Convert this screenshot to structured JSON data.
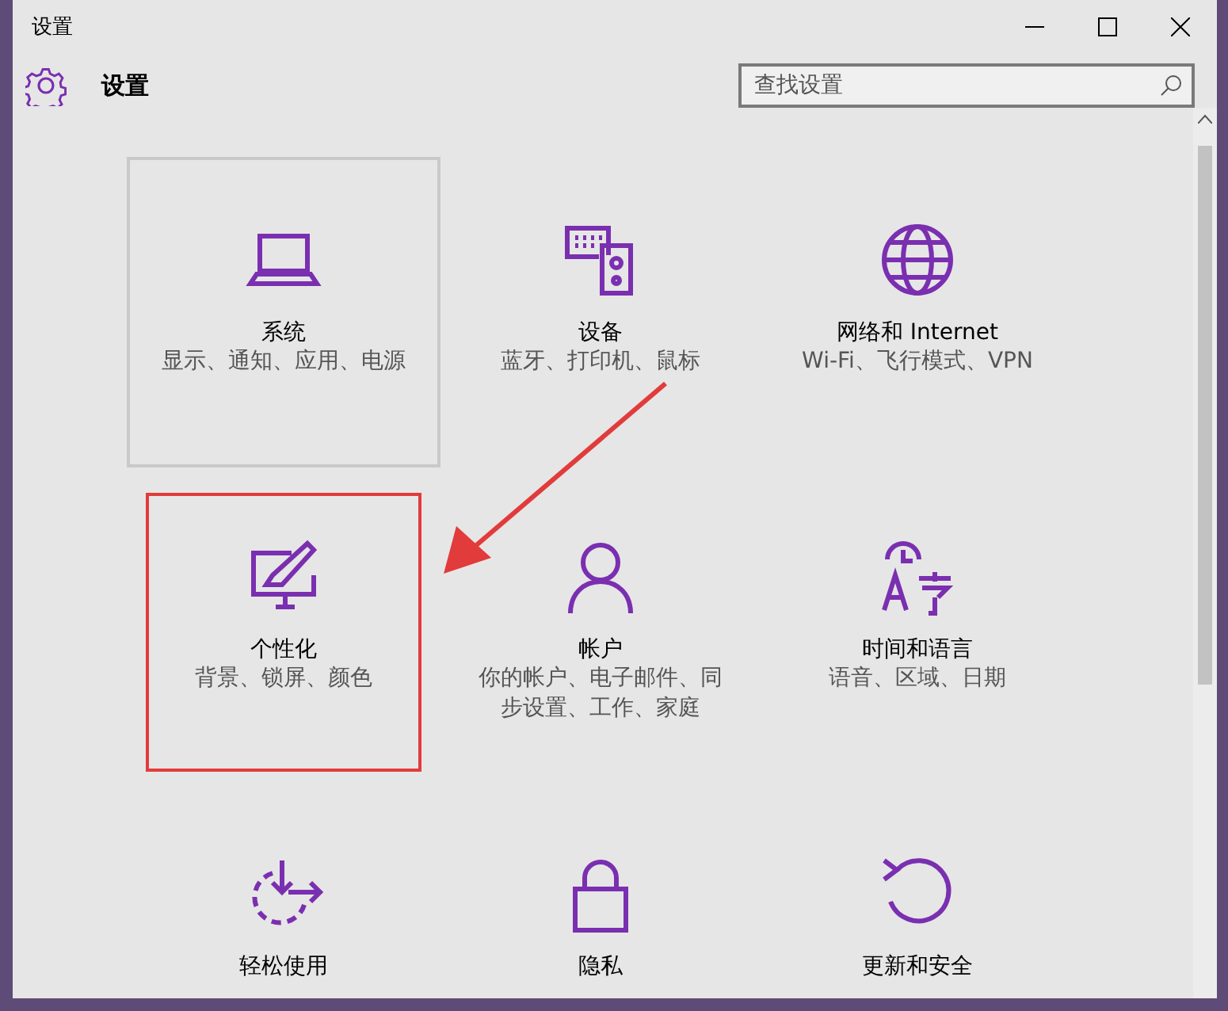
{
  "window": {
    "title": "设置"
  },
  "header": {
    "title": "设置",
    "search": {
      "placeholder": "查找设置"
    }
  },
  "tiles": [
    {
      "label": "系统",
      "description": "显示、通知、应用、电源",
      "selected": true,
      "annotated": false
    },
    {
      "label": "设备",
      "description": "蓝牙、打印机、鼠标",
      "selected": false,
      "annotated": false
    },
    {
      "label": "网络和 Internet",
      "description": "Wi-Fi、飞行模式、VPN",
      "selected": false,
      "annotated": false
    },
    {
      "label": "个性化",
      "description": "背景、锁屏、颜色",
      "selected": false,
      "annotated": true
    },
    {
      "label": "帐户",
      "description": "你的帐户、电子邮件、同步设置、工作、家庭",
      "selected": false,
      "annotated": false
    },
    {
      "label": "时间和语言",
      "description": "语音、区域、日期",
      "selected": false,
      "annotated": false
    },
    {
      "label": "轻松使用",
      "selected": false,
      "annotated": false
    },
    {
      "label": "隐私",
      "selected": false,
      "annotated": false
    },
    {
      "label": "更新和安全",
      "selected": false,
      "annotated": false
    }
  ]
}
